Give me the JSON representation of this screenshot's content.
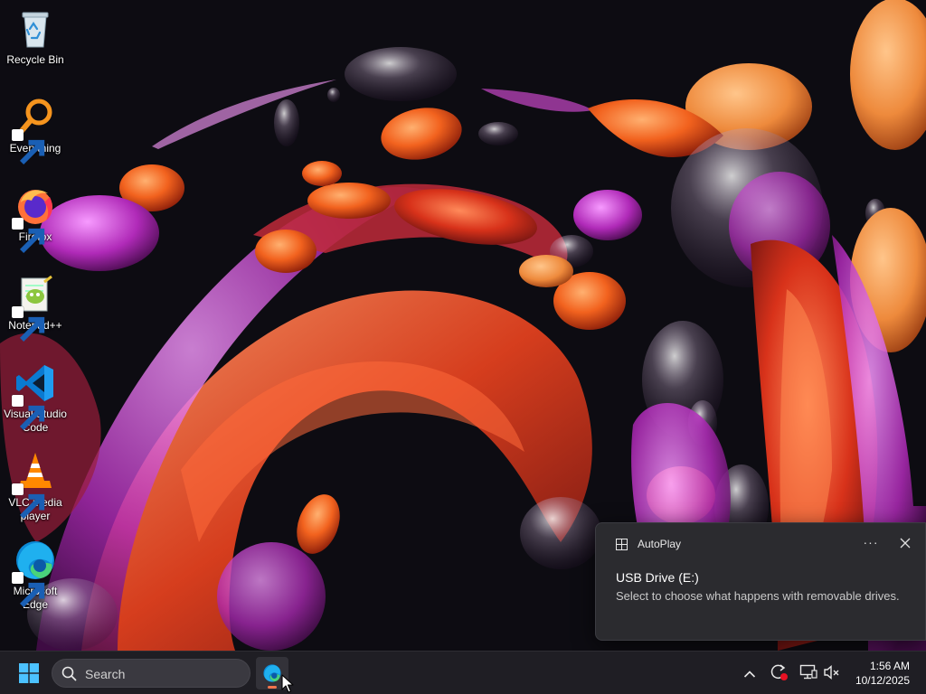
{
  "desktop": {
    "icons": [
      {
        "label": "Recycle Bin",
        "icon": "recycle-bin-icon",
        "shortcut": false
      },
      {
        "label": "Everything",
        "icon": "everything-search-icon",
        "shortcut": true
      },
      {
        "label": "Firefox",
        "icon": "firefox-icon",
        "shortcut": true
      },
      {
        "label": "Notepad++",
        "icon": "notepad-plus-plus-icon",
        "shortcut": true
      },
      {
        "label": "Visual Studio Code",
        "icon": "vscode-icon",
        "shortcut": true
      },
      {
        "label": "VLC media player",
        "icon": "vlc-icon",
        "shortcut": true
      },
      {
        "label": "Microsoft Edge",
        "icon": "edge-icon",
        "shortcut": true
      }
    ]
  },
  "notification": {
    "app_name": "AutoPlay",
    "title": "USB Drive (E:)",
    "body": "Select to choose what happens with removable drives.",
    "more_label": "···"
  },
  "taskbar": {
    "search_label": "Search",
    "pinned": [
      {
        "name": "Microsoft Edge",
        "icon": "edge-icon",
        "running": true
      }
    ],
    "tray": [
      "chevron-up-icon",
      "sync-icon",
      "network-icon",
      "volume-muted-icon"
    ],
    "time": "1:56 AM",
    "date": "10/12/2025"
  },
  "colors": {
    "taskbar_bg": "#1f1e24",
    "toast_bg": "#2b2b2f",
    "running_indicator": "#f2744c",
    "start_blue": "#4cc2ff"
  }
}
